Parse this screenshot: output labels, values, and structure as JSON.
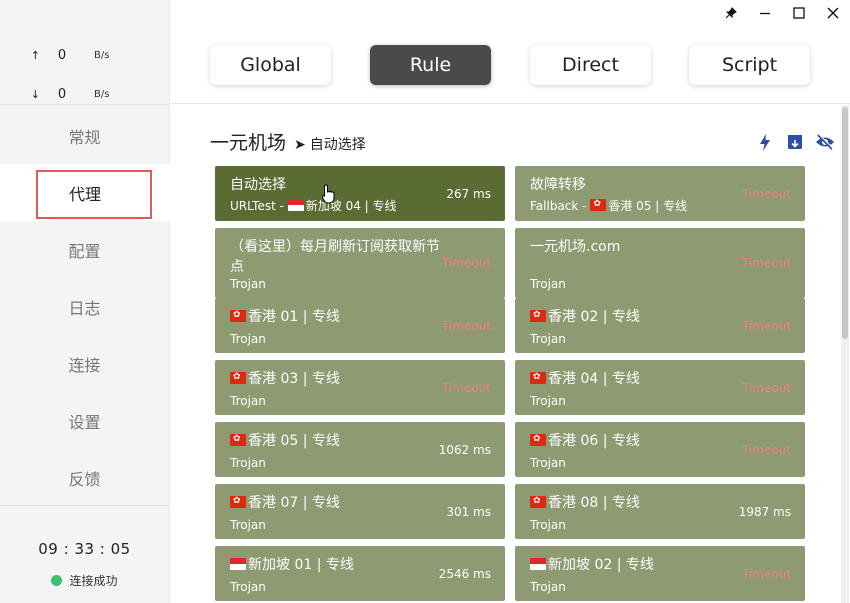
{
  "window": {
    "controls": [
      "pin-icon",
      "minimize-icon",
      "maximize-icon",
      "close-icon"
    ]
  },
  "sidebar": {
    "upload": {
      "arrow": "↑",
      "value": "0",
      "unit": "B/s"
    },
    "download": {
      "arrow": "↓",
      "value": "0",
      "unit": "B/s"
    },
    "items": [
      {
        "label": "常规"
      },
      {
        "label": "代理"
      },
      {
        "label": "配置"
      },
      {
        "label": "日志"
      },
      {
        "label": "连接"
      },
      {
        "label": "设置"
      },
      {
        "label": "反馈"
      }
    ],
    "clock": "09 : 33 : 05",
    "status": "连接成功",
    "active_index": 1
  },
  "modes": {
    "items": [
      {
        "label": "Global"
      },
      {
        "label": "Rule"
      },
      {
        "label": "Direct"
      },
      {
        "label": "Script"
      }
    ],
    "active": "Rule"
  },
  "group": {
    "name": "一元机场",
    "arrow": "➤",
    "selected": "自动选择",
    "tools": [
      "lightning-icon",
      "locate-icon",
      "eye-off-icon"
    ]
  },
  "proxies": [
    {
      "name": "自动选择",
      "type": "URLTest",
      "sub_detail": "新加坡 04 | 专线",
      "sub_flag": "sg",
      "delay": "267 ms",
      "timeout": false,
      "selected": true
    },
    {
      "name": "故障转移",
      "type": "Fallback",
      "sub_detail": "香港 05 | 专线",
      "sub_flag": "hk",
      "delay": "Timeout",
      "timeout": true
    },
    {
      "name": "（看这里）每月刷新订阅获取新节点",
      "type": "Trojan",
      "delay": "Timeout",
      "timeout": true
    },
    {
      "name": "一元机场.com",
      "type": "Trojan",
      "delay": "Timeout",
      "timeout": true
    },
    {
      "name": "香港 01 | 专线",
      "flag": "hk",
      "type": "Trojan",
      "delay": "Timeout",
      "timeout": true
    },
    {
      "name": "香港 02 | 专线",
      "flag": "hk",
      "type": "Trojan",
      "delay": "Timeout",
      "timeout": true
    },
    {
      "name": "香港 03 | 专线",
      "flag": "hk",
      "type": "Trojan",
      "delay": "Timeout",
      "timeout": true
    },
    {
      "name": "香港 04 | 专线",
      "flag": "hk",
      "type": "Trojan",
      "delay": "Timeout",
      "timeout": true
    },
    {
      "name": "香港 05 | 专线",
      "flag": "hk",
      "type": "Trojan",
      "delay": "1062 ms",
      "timeout": false
    },
    {
      "name": "香港 06 | 专线",
      "flag": "hk",
      "type": "Trojan",
      "delay": "Timeout",
      "timeout": true
    },
    {
      "name": "香港 07 | 专线",
      "flag": "hk",
      "type": "Trojan",
      "delay": "301 ms",
      "timeout": false
    },
    {
      "name": "香港 08 | 专线",
      "flag": "hk",
      "type": "Trojan",
      "delay": "1987 ms",
      "timeout": false
    },
    {
      "name": "新加坡 01 | 专线",
      "flag": "sg",
      "type": "Trojan",
      "delay": "2546 ms",
      "timeout": false
    },
    {
      "name": "新加坡 02 | 专线",
      "flag": "sg",
      "type": "Trojan",
      "delay": "Timeout",
      "timeout": true
    }
  ],
  "colors": {
    "card": "#8d9a72",
    "card_selected": "#5a6b33",
    "timeout": "#f08080",
    "mode_active": "#4a4a4a",
    "highlight_box": "#e05a5a",
    "status_dot": "#3fbf6f",
    "tool_icon": "#2b4fa8"
  }
}
